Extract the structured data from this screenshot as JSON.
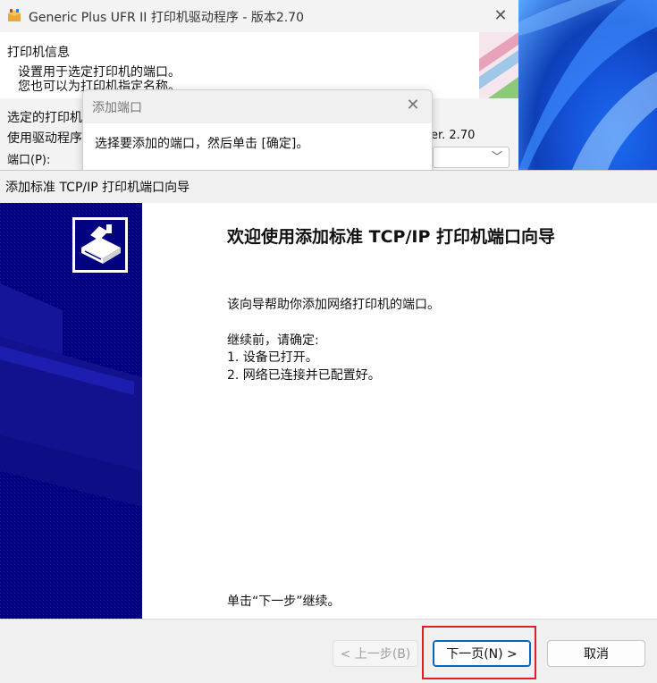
{
  "main_window": {
    "title": "Generic Plus UFR II 打印机驱动程序 - 版本2.70",
    "header_title": "打印机信息",
    "header_line1": "设置用于选定打印机的端口。",
    "header_line2": "您也可以为打印机指定名称。",
    "selected_printer_label": "选定的打印机",
    "driver_label": "使用驱动程序",
    "version_text": "er. 2.70",
    "port_label": "端口(P):"
  },
  "add_port_dialog": {
    "title": "添加端口",
    "message": "选择要添加的端口，然后单击 [确定]。"
  },
  "wizard": {
    "title": "添加标准 TCP/IP 打印机端口向导",
    "heading": "欢迎使用添加标准 TCP/IP 打印机端口向导",
    "intro": "该向导帮助你添加网络打印机的端口。",
    "before_continue": "继续前，请确定:",
    "item1": "1.  设备已打开。",
    "item2": "2.  网络已连接并已配置好。",
    "continue_hint": "单击“下一步”继续。",
    "back_label": "< 上一步(B)",
    "next_label": "下一页(N) >",
    "cancel_label": "取消"
  },
  "colors": {
    "banner": "#000080",
    "highlight": "#e02020",
    "accent": "#0067c0"
  }
}
